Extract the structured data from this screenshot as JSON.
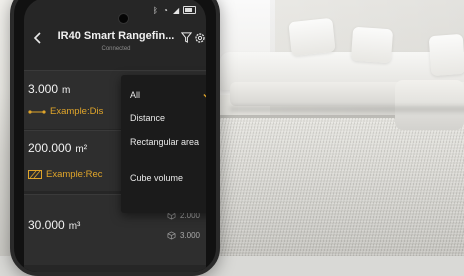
{
  "app": {
    "title": "IR40 Smart Rangefin...",
    "status": "Connected"
  },
  "measurements": [
    {
      "value": "3.000",
      "unit": "m",
      "example": "Example:Dis"
    },
    {
      "value": "200.000",
      "unit": "m²",
      "example": "Example:Rec"
    },
    {
      "value": "30.000",
      "unit": "m³",
      "side_values": [
        "2.000",
        "3.000"
      ]
    }
  ],
  "filter_menu": {
    "items": [
      "All",
      "Distance",
      "Rectangular area",
      "Cube volume"
    ],
    "selected": "All"
  },
  "colors": {
    "accent": "#e0a52a",
    "screen_bg": "#262626",
    "menu_bg": "#1b1b1b"
  },
  "icons": [
    "back-icon",
    "filter-icon",
    "gear-icon",
    "check-icon",
    "line-measure-icon",
    "area-icon",
    "cube-icon"
  ]
}
